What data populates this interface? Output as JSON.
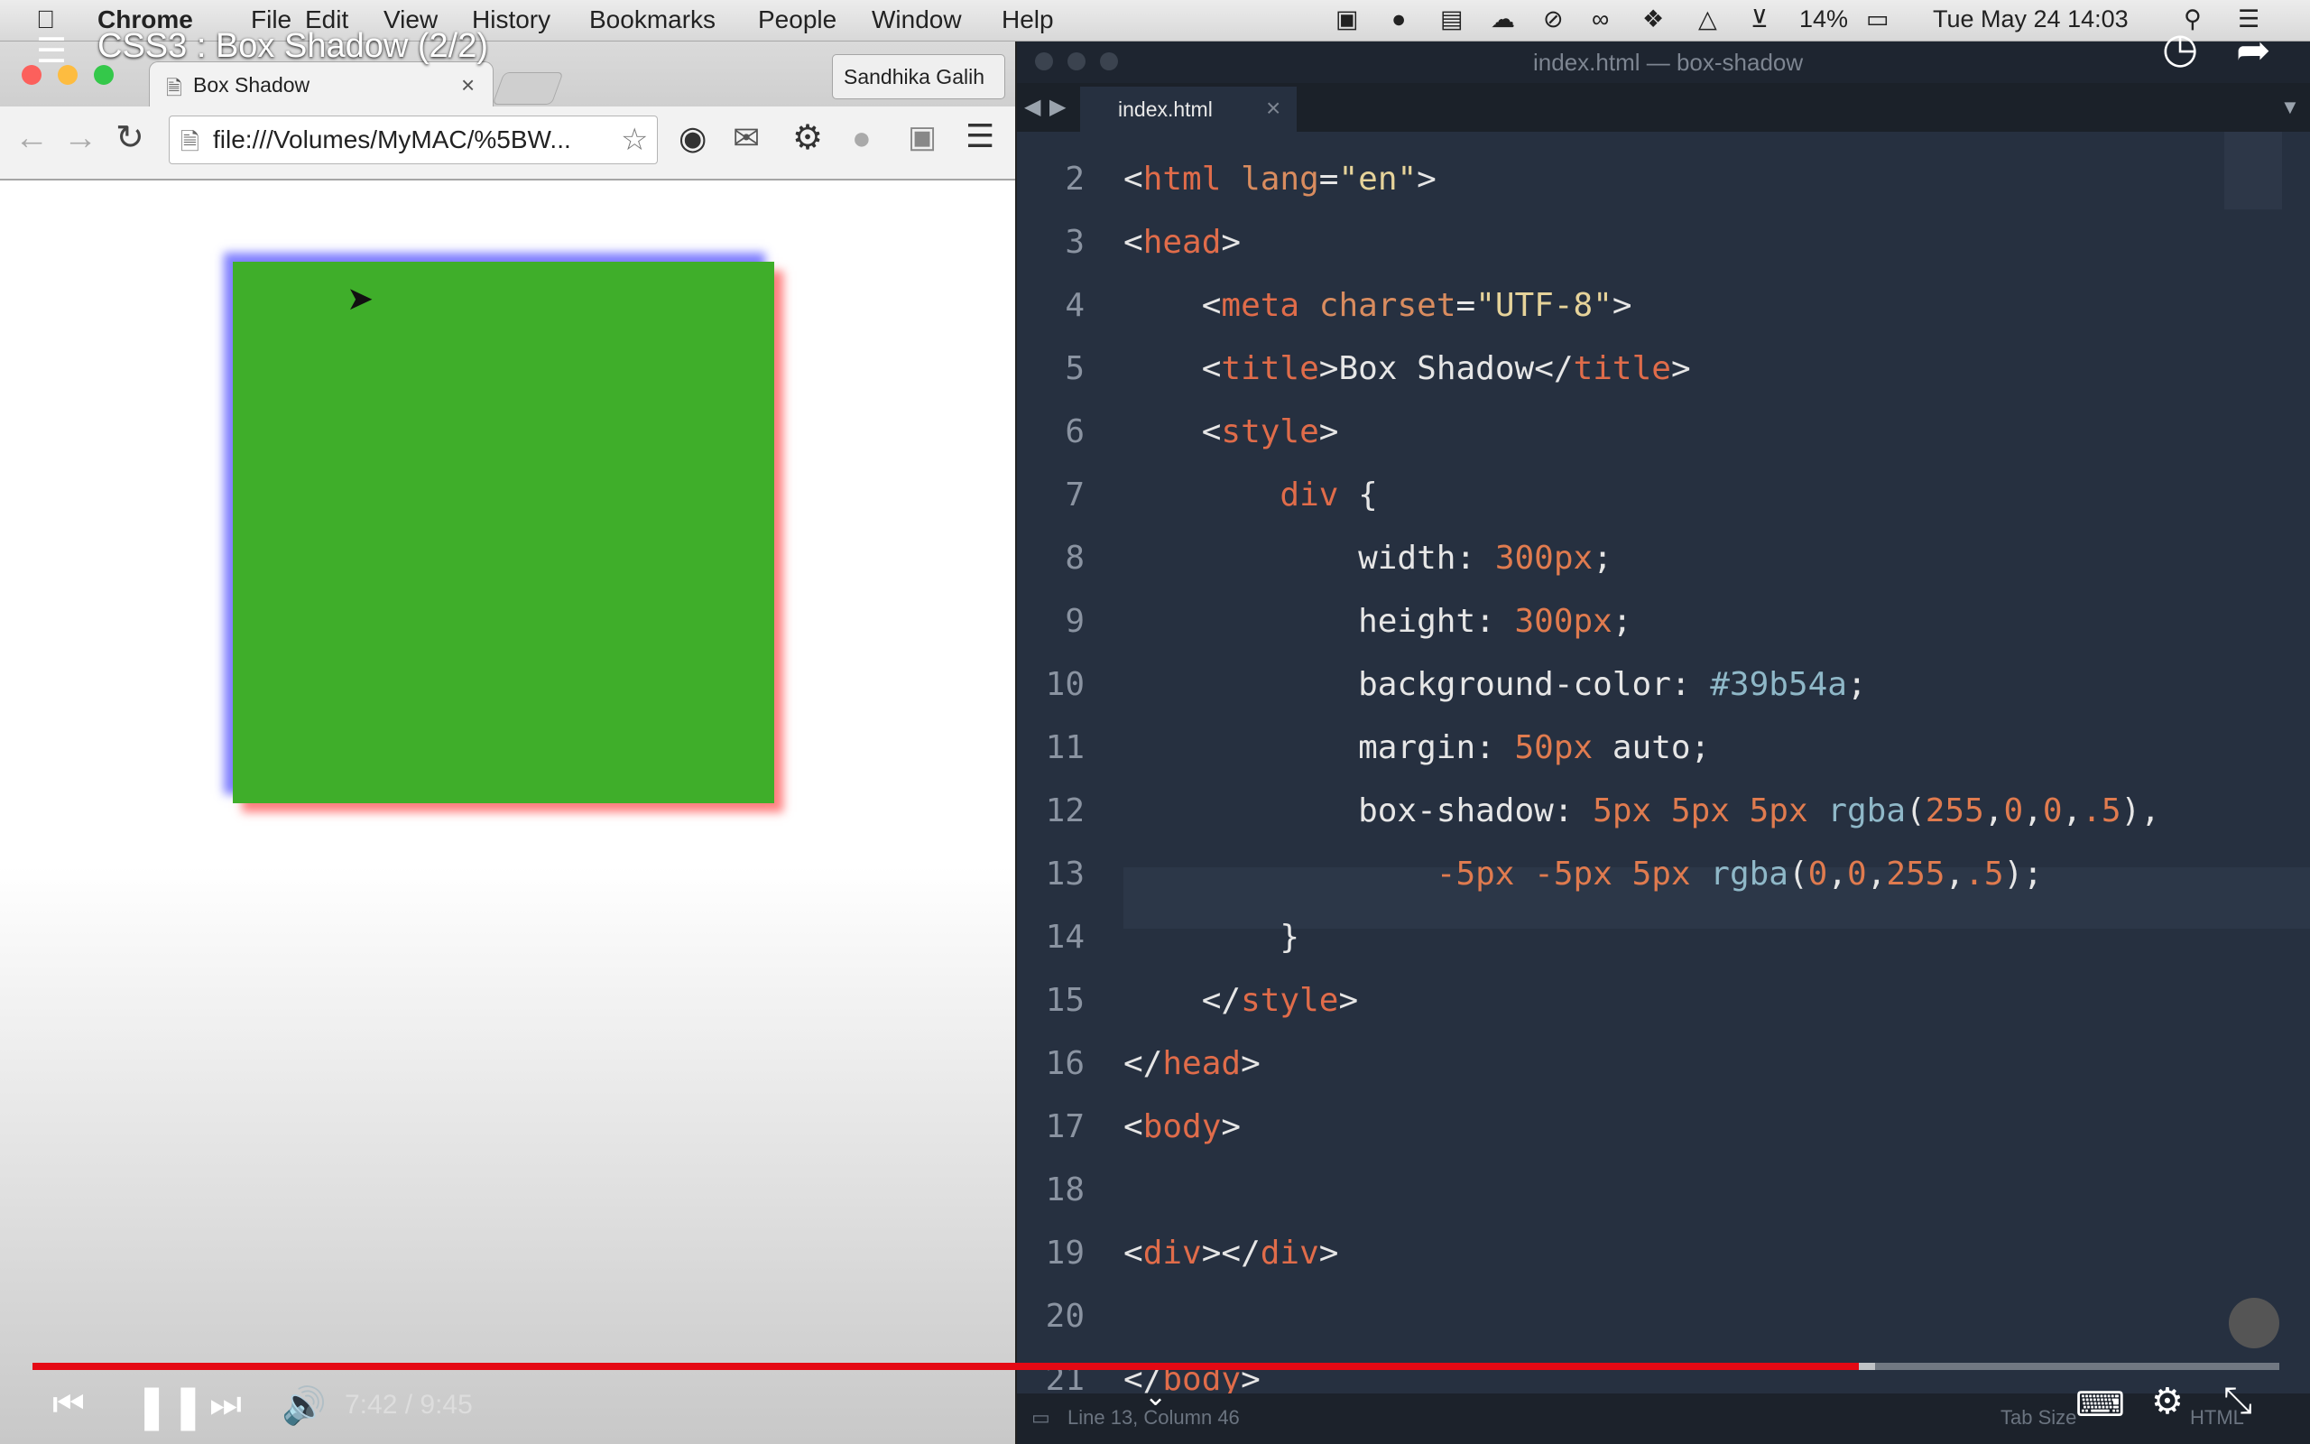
{
  "menubar": {
    "items": [
      "Chrome",
      "File",
      "Edit",
      "View",
      "History",
      "Bookmarks",
      "People",
      "Window",
      "Help"
    ],
    "battery": "14%",
    "clock": "Tue May 24  14:03"
  },
  "video": {
    "title": "CSS3 : Box Shadow (2/2)",
    "time": "7:42 / 9:45",
    "progress": 0.813,
    "buffered": 0.82
  },
  "browser": {
    "tab_title": "Box Shadow",
    "profile_name": "Sandhika Galih",
    "url": "file:///Volumes/MyMAC/%5BW..."
  },
  "editor": {
    "window_title": "index.html — box-shadow",
    "tab_label": "index.html",
    "status": "Line 13, Column 46",
    "tab_size": "Tab Size",
    "syntax": "HTML",
    "line_numbers": [
      "2",
      "3",
      "4",
      "5",
      "6",
      "7",
      "8",
      "9",
      "10",
      "11",
      "12",
      "13",
      "14",
      "15",
      "16",
      "17",
      "18",
      "19",
      "20",
      "21"
    ]
  },
  "colors": {
    "demo_box": "#39b54a",
    "progress": "#e50914"
  }
}
